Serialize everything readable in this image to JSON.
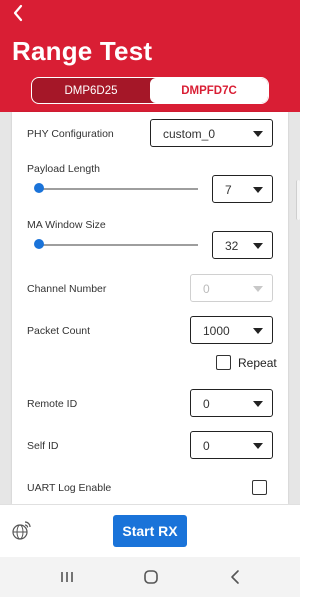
{
  "header": {
    "back_icon": "chevron-left-icon",
    "title": "Range Test",
    "tabs": [
      {
        "label": "DMP6D25",
        "selected": false
      },
      {
        "label": "DMPFD7C",
        "selected": true
      }
    ],
    "brand_color": "#d91e34"
  },
  "form": {
    "phy_configuration": {
      "label": "PHY Configuration",
      "value": "custom_0"
    },
    "payload_length": {
      "label": "Payload Length",
      "value": "7",
      "slider_fraction": 0.0
    },
    "ma_window_size": {
      "label": "MA Window Size",
      "value": "32",
      "slider_fraction": 0.0
    },
    "channel_number": {
      "label": "Channel Number",
      "value": "0",
      "enabled": false
    },
    "packet_count": {
      "label": "Packet Count",
      "value": "1000"
    },
    "repeat": {
      "label": "Repeat",
      "checked": false
    },
    "remote_id": {
      "label": "Remote ID",
      "value": "0"
    },
    "self_id": {
      "label": "Self ID",
      "value": "0"
    },
    "uart_log_enable": {
      "label": "UART Log Enable",
      "checked": false
    }
  },
  "footer": {
    "signal_icon": "globe-signal-icon",
    "start_button_label": "Start RX",
    "accent_color": "#1a73d9"
  },
  "system_nav": {
    "recents_icon": "recents-icon",
    "home_icon": "home-icon",
    "back_icon": "back-icon"
  }
}
